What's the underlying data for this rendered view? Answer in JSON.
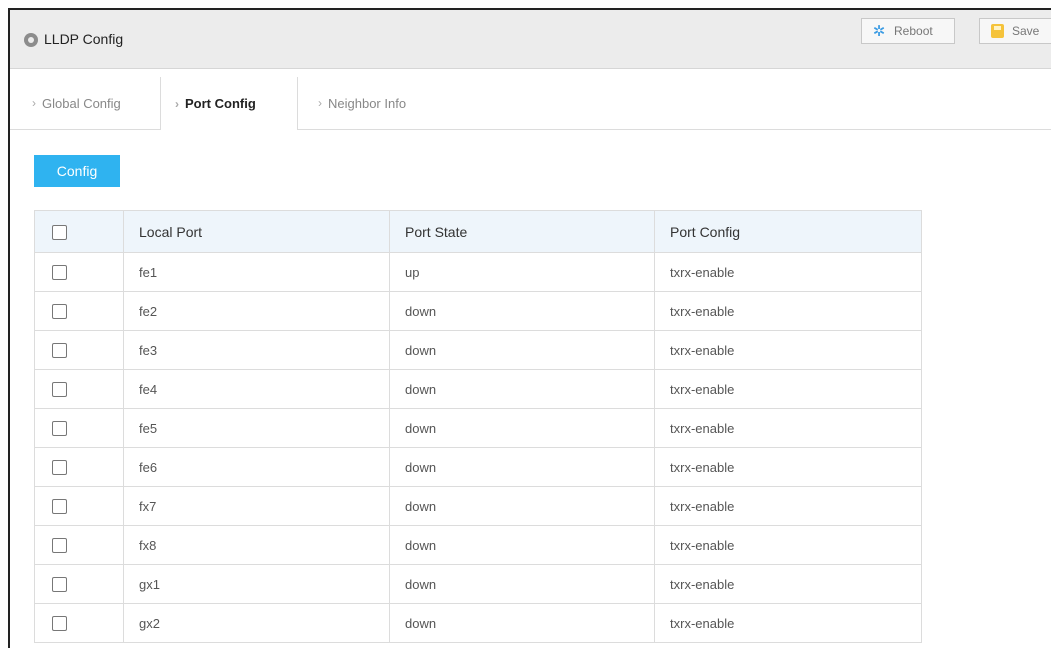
{
  "window": {
    "title": "LLDP Config"
  },
  "toolbar": {
    "reboot_label": "Reboot",
    "save_label": "Save"
  },
  "tabs": [
    {
      "label": "Global Config",
      "active": false
    },
    {
      "label": "Port Config",
      "active": true
    },
    {
      "label": "Neighbor Info",
      "active": false
    }
  ],
  "actions": {
    "config_label": "Config"
  },
  "table": {
    "headers": [
      "Local Port",
      "Port State",
      "Port Config"
    ],
    "rows": [
      {
        "local_port": "fe1",
        "port_state": "up",
        "port_config": "txrx-enable"
      },
      {
        "local_port": "fe2",
        "port_state": "down",
        "port_config": "txrx-enable"
      },
      {
        "local_port": "fe3",
        "port_state": "down",
        "port_config": "txrx-enable"
      },
      {
        "local_port": "fe4",
        "port_state": "down",
        "port_config": "txrx-enable"
      },
      {
        "local_port": "fe5",
        "port_state": "down",
        "port_config": "txrx-enable"
      },
      {
        "local_port": "fe6",
        "port_state": "down",
        "port_config": "txrx-enable"
      },
      {
        "local_port": "fx7",
        "port_state": "down",
        "port_config": "txrx-enable"
      },
      {
        "local_port": "fx8",
        "port_state": "down",
        "port_config": "txrx-enable"
      },
      {
        "local_port": "gx1",
        "port_state": "down",
        "port_config": "txrx-enable"
      },
      {
        "local_port": "gx2",
        "port_state": "down",
        "port_config": "txrx-enable"
      }
    ]
  },
  "colors": {
    "accent": "#2fb3f0",
    "header_bg": "#eef5fb",
    "titlebar_bg": "#ececec"
  }
}
